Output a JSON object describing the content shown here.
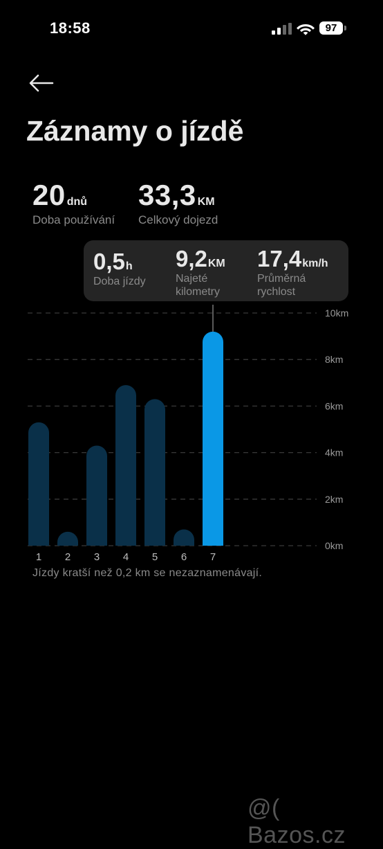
{
  "status": {
    "time": "18:58",
    "battery": "97"
  },
  "header": {
    "title": "Záznamy o jízdě"
  },
  "summary": {
    "days": {
      "value": "20",
      "unit": "dnů",
      "label": "Doba používání"
    },
    "distance": {
      "value": "33,3",
      "unit": "KM",
      "label": "Celkový dojezd"
    }
  },
  "tooltip": {
    "duration": {
      "value": "0,5",
      "unit": "h",
      "label_1": "Doba jízdy",
      "label_2": ""
    },
    "distance": {
      "value": "9,2",
      "unit": "KM",
      "label_1": "Najeté",
      "label_2": "kilometry"
    },
    "speed": {
      "value": "17,4",
      "unit": "km/h",
      "label_1": "Průměrná",
      "label_2": "rychlost"
    }
  },
  "chart_data": {
    "type": "bar",
    "categories": [
      "1",
      "2",
      "3",
      "4",
      "5",
      "6",
      "7"
    ],
    "values": [
      5.3,
      0.6,
      4.3,
      6.9,
      6.3,
      0.7,
      9.2
    ],
    "ylim": [
      0,
      10
    ],
    "y_ticks": [
      "0km",
      "2km",
      "4km",
      "6km",
      "8km",
      "10km"
    ],
    "selected_index": 6,
    "colors": {
      "bar": "#0a3049",
      "selected": "#0a98e6",
      "grid": "#3a3a3a"
    }
  },
  "footnote": "Jízdy kratší než 0,2 km se nezaznamenávají.",
  "watermark": "@( Bazos.cz"
}
